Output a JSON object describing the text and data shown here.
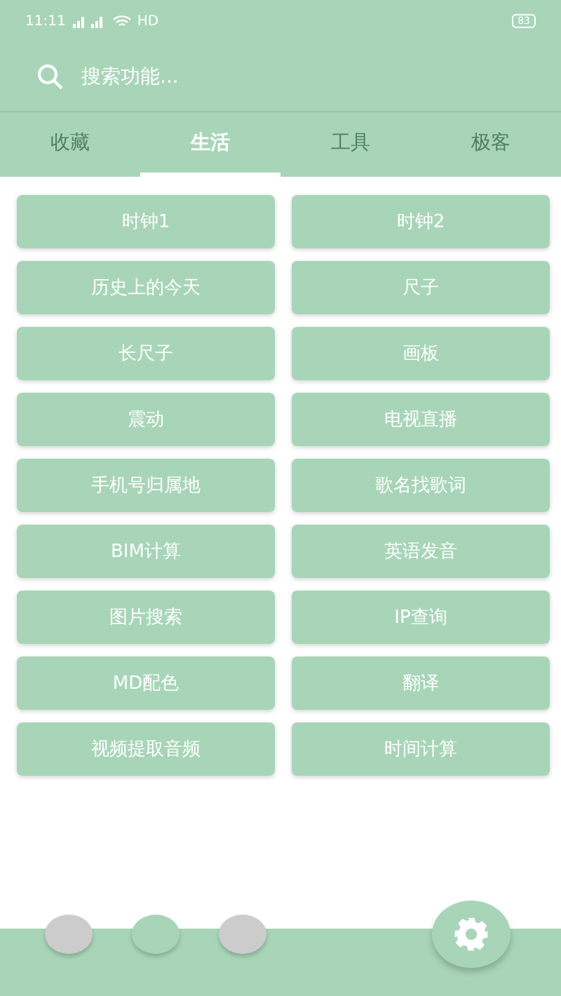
{
  "status_bar": {
    "time": "11:11",
    "network": "HD",
    "battery": "83"
  },
  "search": {
    "placeholder": "搜索功能..."
  },
  "tabs": [
    {
      "label": "收藏",
      "selected": false
    },
    {
      "label": "生活",
      "selected": true
    },
    {
      "label": "工具",
      "selected": false
    },
    {
      "label": "极客",
      "selected": false
    }
  ],
  "functions": [
    "时钟1",
    "时钟2",
    "历史上的今天",
    "尺子",
    "长尺子",
    "画板",
    "震动",
    "电视直播",
    "手机号归属地",
    "歌名找歌词",
    "BIM计算",
    "英语发音",
    "图片搜索",
    "IP查询",
    "MD配色",
    "翻译",
    "视频提取音频",
    "时间计算"
  ],
  "page_dots": [
    {
      "selected": false
    },
    {
      "selected": true
    },
    {
      "selected": false
    }
  ]
}
